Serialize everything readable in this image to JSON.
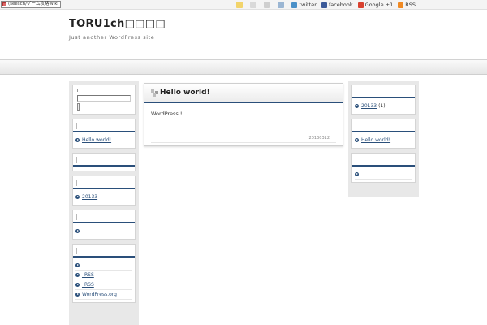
{
  "browser_tab": {
    "title": "(seesch/ゲーム攻略Wiki"
  },
  "topbar": {
    "links": [
      {
        "label": "twitter",
        "icon": "twitter-icon",
        "color": "#4a90c8"
      },
      {
        "label": "facebook",
        "icon": "facebook-icon",
        "color": "#3b5998"
      },
      {
        "label": "Google +1",
        "icon": "google-plus-icon",
        "color": "#d8412f"
      },
      {
        "label": "RSS",
        "icon": "rss-icon",
        "color": "#f08a24"
      }
    ]
  },
  "header": {
    "site_title": "TORU1ch□□□□",
    "site_description": "Just another WordPress site"
  },
  "left_sidebar": {
    "recent_posts": [
      {
        "label": "Hello world!"
      }
    ],
    "archives": [
      {
        "label": "20133"
      }
    ],
    "meta": [
      {
        "label": ""
      },
      {
        "label": "_RSS"
      },
      {
        "label": "_RSS"
      },
      {
        "label": "WordPress.org"
      }
    ]
  },
  "post": {
    "title": "Hello world!",
    "body": "WordPress  !",
    "date": "20130312",
    "mark": "·"
  },
  "right_sidebar": {
    "archives": [
      {
        "label": "20133",
        "count": "(1)"
      }
    ],
    "recent_posts": [
      {
        "label": "Hello world!"
      }
    ],
    "categories": [
      {
        "label": ""
      }
    ]
  },
  "colors": {
    "accent": "#2a4f7a",
    "column_bg": "#e8e8e8"
  }
}
